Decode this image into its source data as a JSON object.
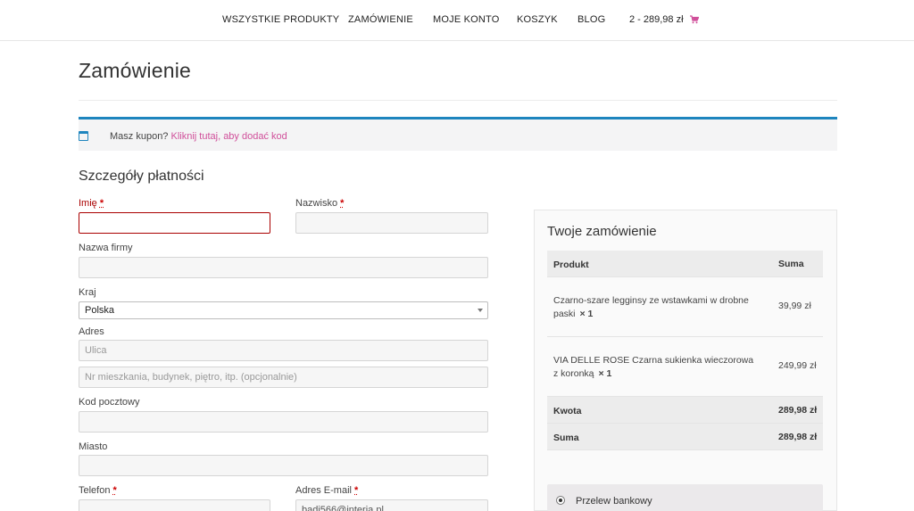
{
  "nav": {
    "items": [
      {
        "label": "WSZYSTKIE PRODUKTY"
      },
      {
        "label": "ZAMÓWIENIE"
      },
      {
        "label": "MOJE KONTO"
      },
      {
        "label": "KOSZYK"
      },
      {
        "label": "BLOG"
      }
    ],
    "cart_summary": "2 - 289,98 zł",
    "cart_icon": "shopping-cart-icon",
    "accent_color": "#d04f9a"
  },
  "page": {
    "title": "Zamówienie"
  },
  "coupon": {
    "prefix": "Masz kupon?",
    "link": "Kliknij tutaj, aby dodać kod",
    "icon": "calendar-icon",
    "border_color": "#1e85be"
  },
  "billing": {
    "title": "Szczegóły płatności",
    "required_mark": "*",
    "first_name": {
      "label": "Imię",
      "value": ""
    },
    "last_name": {
      "label": "Nazwisko",
      "value": ""
    },
    "company": {
      "label": "Nazwa firmy",
      "value": ""
    },
    "country": {
      "label": "Kraj",
      "value": "Polska"
    },
    "address": {
      "label": "Adres",
      "placeholder1": "Ulica",
      "placeholder2": "Nr mieszkania, budynek, piętro, itp. (opcjonalnie)"
    },
    "postcode": {
      "label": "Kod pocztowy",
      "value": ""
    },
    "city": {
      "label": "Miasto",
      "value": ""
    },
    "phone": {
      "label": "Telefon",
      "value": ""
    },
    "email": {
      "label": "Adres E-mail",
      "value": "badi566@interia.pl"
    }
  },
  "order": {
    "title": "Twoje zamówienie",
    "head": {
      "product": "Produkt",
      "total": "Suma"
    },
    "items": [
      {
        "name": "Czarno-szare legginsy ze wstawkami w drobne paski",
        "qty": "× 1",
        "price": "39,99 zł"
      },
      {
        "name": "VIA DELLE ROSE Czarna sukienka wieczorowa z koronką",
        "qty": "× 1",
        "price": "249,99 zł"
      }
    ],
    "subtotal": {
      "label": "Kwota",
      "value": "289,98 zł"
    },
    "total": {
      "label": "Suma",
      "value": "289,98 zł"
    },
    "payment": {
      "label": "Przelew bankowy"
    }
  }
}
